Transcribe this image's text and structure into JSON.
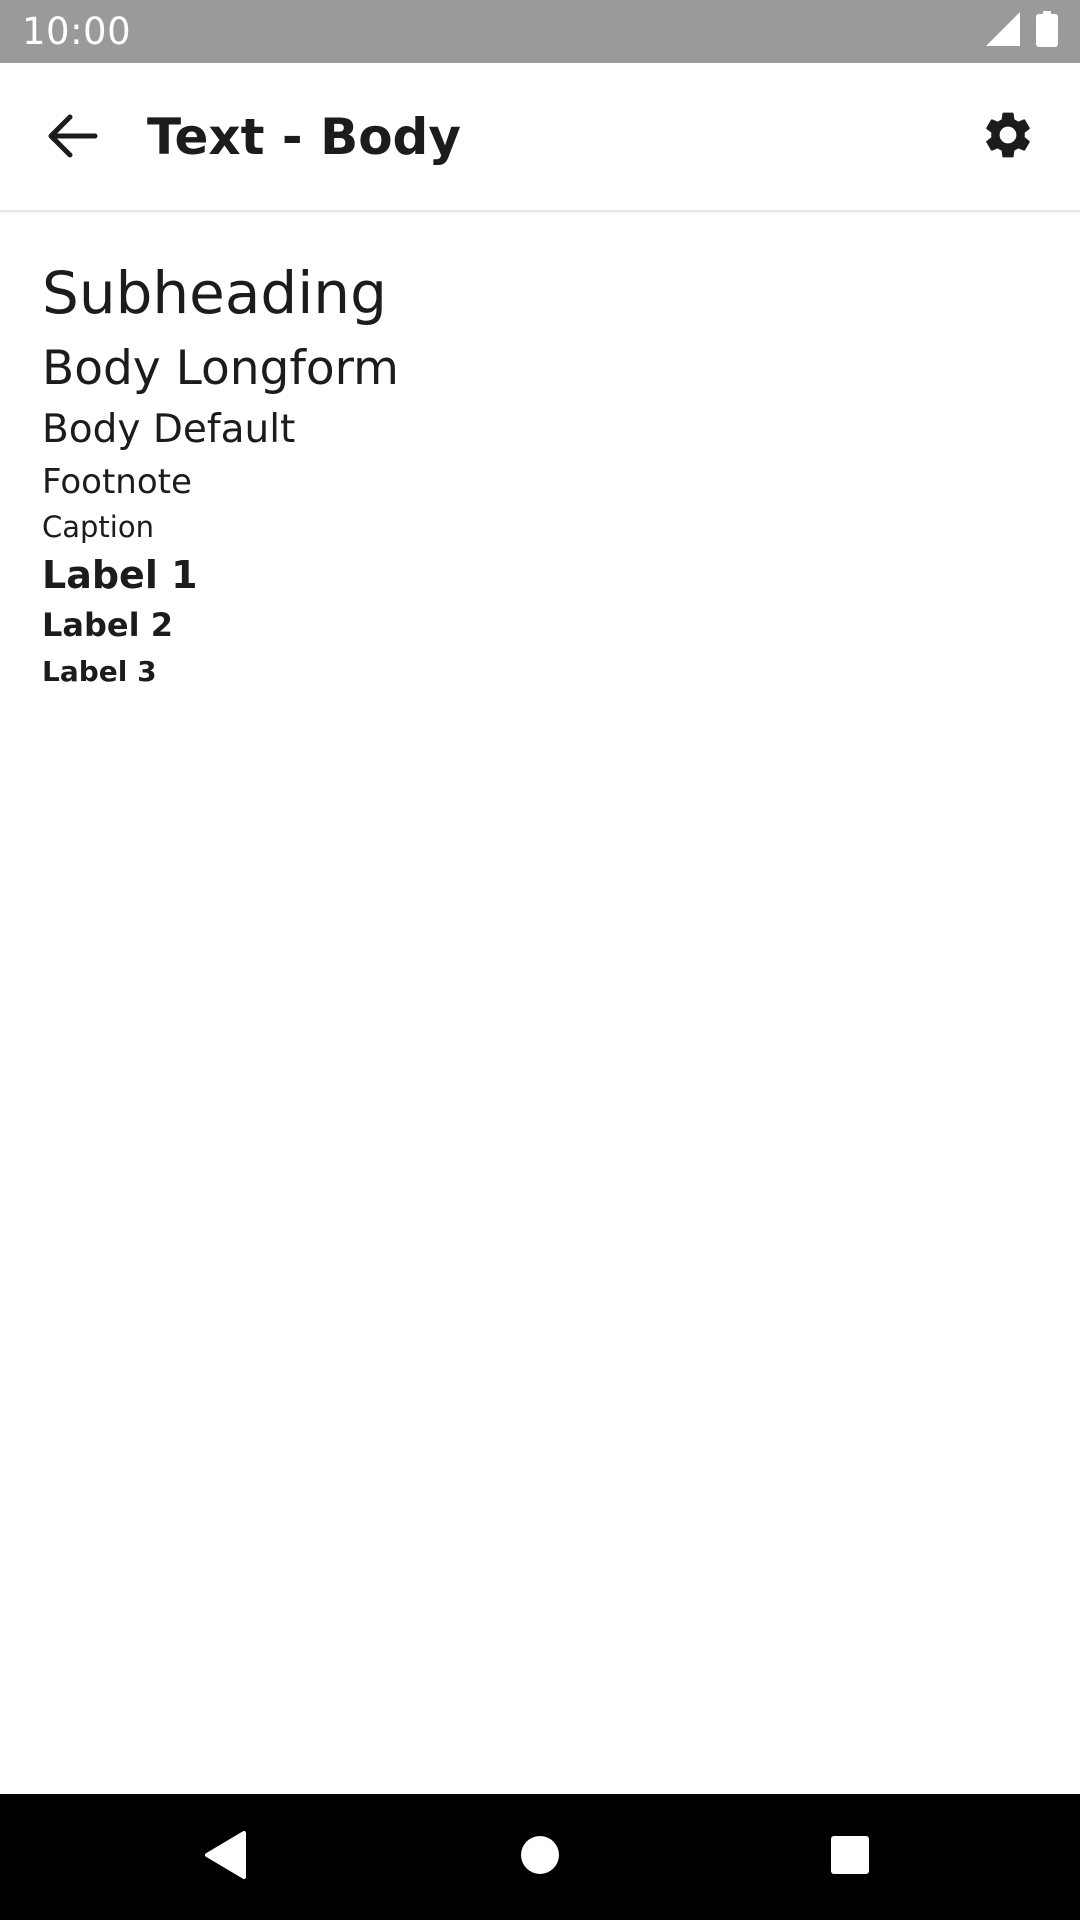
{
  "status_bar": {
    "time": "10:00",
    "icons": [
      "cell-signal-icon",
      "battery-icon"
    ],
    "background": "#9a9a9a"
  },
  "app_bar": {
    "back_icon": "arrow-back-icon",
    "title": "Text - Body",
    "settings_icon": "gear-icon"
  },
  "samples": [
    {
      "label": "Subheading"
    },
    {
      "label": "Body Longform"
    },
    {
      "label": "Body Default"
    },
    {
      "label": "Footnote"
    },
    {
      "label": "Caption"
    },
    {
      "label": "Label 1"
    },
    {
      "label": "Label 2"
    },
    {
      "label": "Label 3"
    }
  ],
  "nav_bar": {
    "icons": [
      "nav-back-icon",
      "nav-home-icon",
      "nav-recents-icon"
    ],
    "background": "#000000"
  },
  "colors": {
    "text": "#1c1c1c",
    "surface": "#ffffff"
  }
}
